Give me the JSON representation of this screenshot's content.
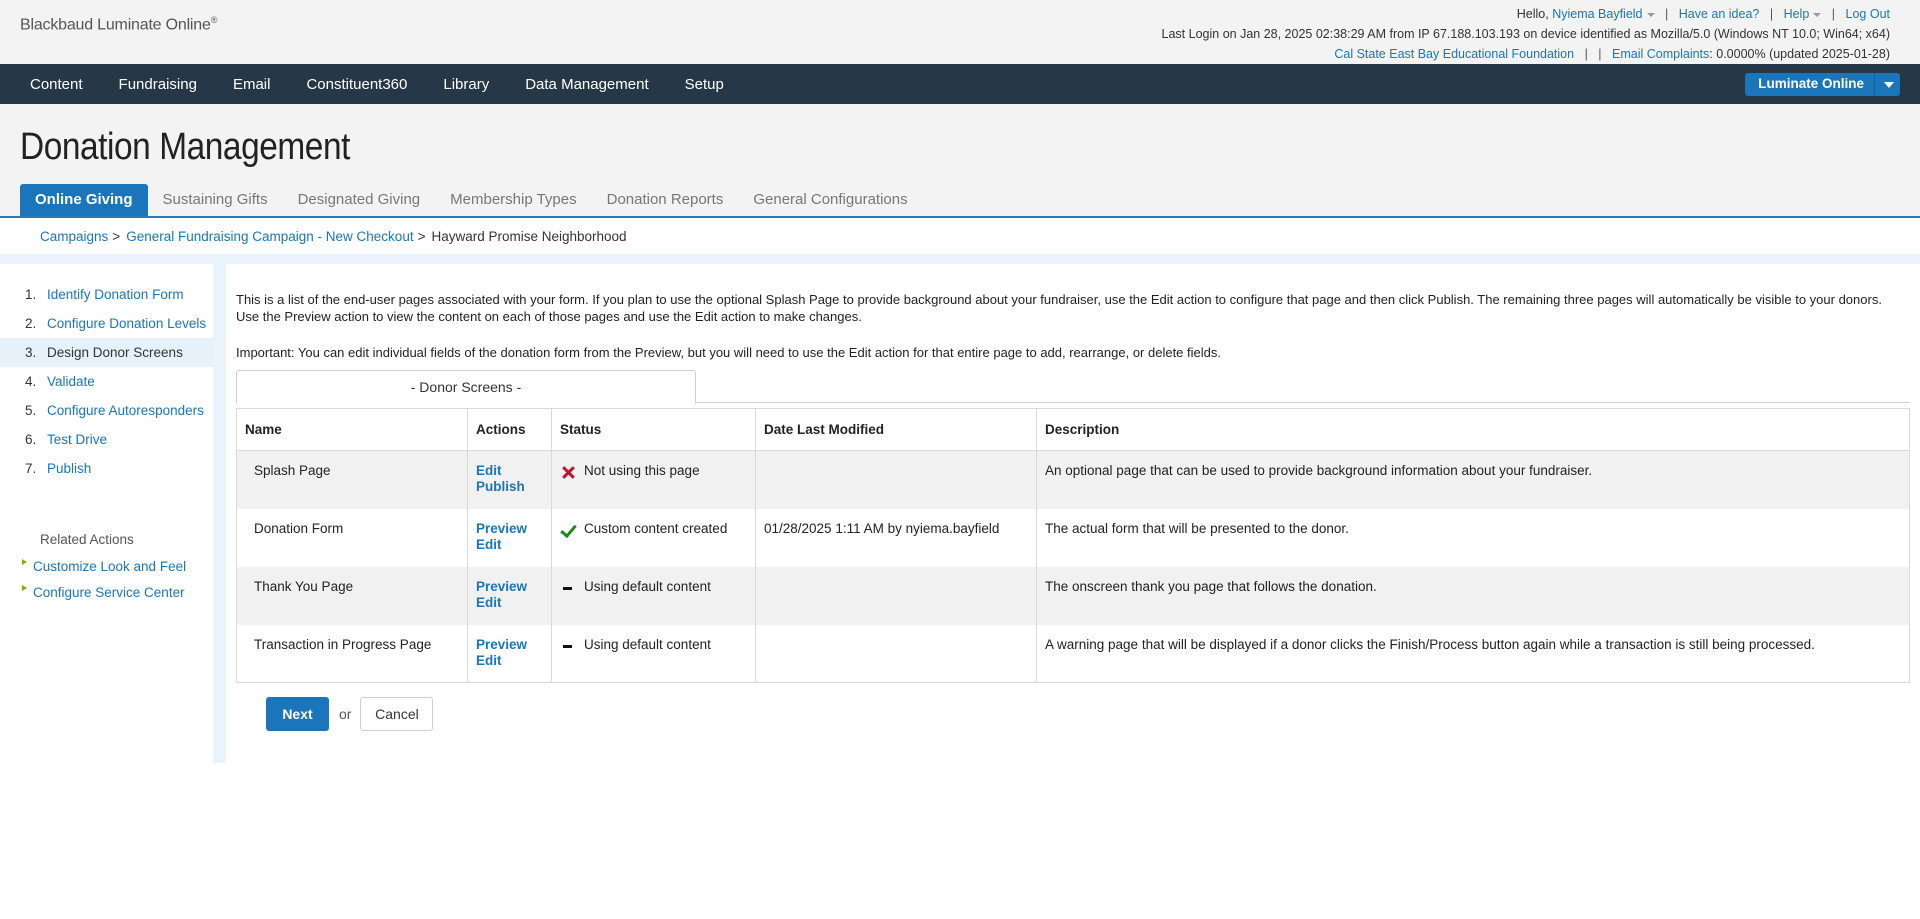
{
  "header": {
    "brand": "Blackbaud Luminate Online",
    "brand_mark": "®",
    "hello": "Hello,",
    "user_name": "Nyiema Bayfield",
    "have_idea": "Have an idea?",
    "help": "Help",
    "logout": "Log Out",
    "last_login": "Last Login on Jan 28, 2025 02:38:29 AM from IP 67.188.103.193 on device identified as Mozilla/5.0 (Windows NT 10.0; Win64; x64)",
    "org": "Cal State East Bay Educational Foundation",
    "email_complaints_label": "Email Complaints",
    "email_complaints_value": ": 0.0000% (updated 2025-01-28)"
  },
  "nav": {
    "items": [
      "Content",
      "Fundraising",
      "Email",
      "Constituent360",
      "Library",
      "Data Management",
      "Setup"
    ],
    "product_button": "Luminate Online"
  },
  "page": {
    "title": "Donation Management",
    "tabs": [
      "Online Giving",
      "Sustaining Gifts",
      "Designated Giving",
      "Membership Types",
      "Donation Reports",
      "General Configurations"
    ]
  },
  "breadcrumb": {
    "items": [
      "Campaigns",
      "General Fundraising Campaign - New Checkout"
    ],
    "current": "Hayward Promise Neighborhood",
    "sep": ">"
  },
  "sidebar": {
    "steps": [
      {
        "num": "1.",
        "label": "Identify Donation Form"
      },
      {
        "num": "2.",
        "label": "Configure Donation Levels"
      },
      {
        "num": "3.",
        "label": "Design Donor Screens"
      },
      {
        "num": "4.",
        "label": "Validate"
      },
      {
        "num": "5.",
        "label": "Configure Autoresponders"
      },
      {
        "num": "6.",
        "label": "Test Drive"
      },
      {
        "num": "7.",
        "label": "Publish"
      }
    ],
    "related_title": "Related Actions",
    "related": [
      "Customize Look and Feel",
      "Configure Service Center"
    ]
  },
  "content": {
    "intro": "This is a list of the end-user pages associated with your form. If you plan to use the optional Splash Page to provide background about your fundraiser, use the Edit action to configure that page and then click Publish. The remaining three pages will automatically be visible to your donors. Use the Preview action to view the content on each of those pages and use the Edit action to make changes.",
    "important": "Important: You can edit individual fields of the donation form from the Preview, but you will need to use the Edit action for that entire page to add, rearrange, or delete fields.",
    "tab_label": "- Donor Screens -",
    "columns": [
      "Name",
      "Actions",
      "Status",
      "Date Last Modified",
      "Description"
    ],
    "rows": [
      {
        "name": "Splash Page",
        "actions": [
          "Edit",
          "Publish"
        ],
        "status": "Not using this page",
        "status_icon": "x-icon",
        "modified": "",
        "description": "An optional page that can be used to provide background information about your fundraiser."
      },
      {
        "name": "Donation Form",
        "actions": [
          "Preview",
          "Edit"
        ],
        "status": "Custom content created",
        "status_icon": "check-icon",
        "modified": "01/28/2025 1:11 AM by nyiema.bayfield",
        "description": "The actual form that will be presented to the donor."
      },
      {
        "name": "Thank You Page",
        "actions": [
          "Preview",
          "Edit"
        ],
        "status": "Using default content",
        "status_icon": "dash-icon",
        "modified": "",
        "description": "The onscreen thank you page that follows the donation."
      },
      {
        "name": "Transaction in Progress Page",
        "actions": [
          "Preview",
          "Edit"
        ],
        "status": "Using default content",
        "status_icon": "dash-icon",
        "modified": "",
        "description": "A warning page that will be displayed if a donor clicks the Finish/Process button again while a transaction is still being processed."
      }
    ],
    "next_label": "Next",
    "or_label": "or",
    "cancel_label": "Cancel"
  },
  "colors": {
    "nav_bg": "#263848",
    "accent": "#1a75bb",
    "error_red": "#c0142a",
    "success_green": "#1d8a1d",
    "bullet_green": "#7ab800"
  }
}
